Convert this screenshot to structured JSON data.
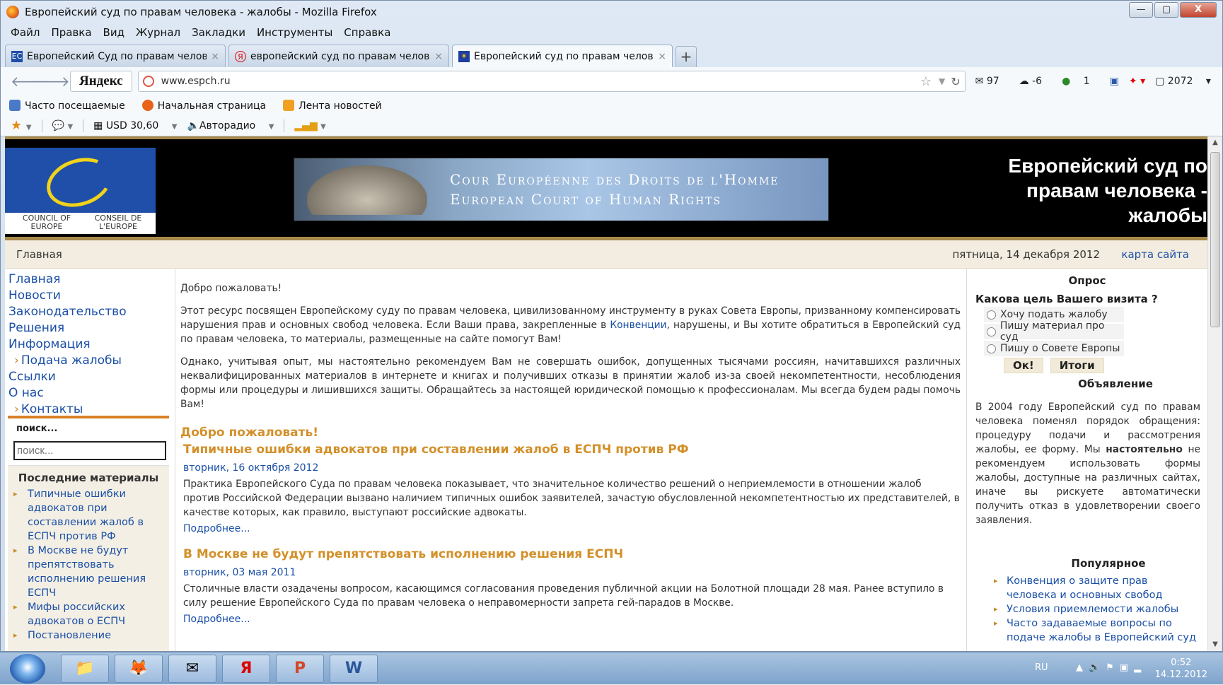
{
  "window": {
    "title": "Европейский суд по правам человека - жалобы - Mozilla Firefox",
    "buttons": [
      "—",
      "▢",
      "X"
    ]
  },
  "menubar": [
    "Файл",
    "Правка",
    "Вид",
    "Журнал",
    "Закладки",
    "Инструменты",
    "Справка"
  ],
  "tabs": [
    {
      "label": "Европейский Суд по правам челове...",
      "active": false
    },
    {
      "label": "европейский суд по правам челове...",
      "active": false
    },
    {
      "label": "Европейский суд по правам челове...",
      "active": true
    }
  ],
  "nav": {
    "yandex": "Яндекс",
    "url": "www.espch.ru",
    "mail_count": "97",
    "weather": "-6",
    "counter1": "1",
    "counter2": "2072"
  },
  "bookmarks": [
    "Часто посещаемые",
    "Начальная страница",
    "Лента новостей"
  ],
  "yabar": {
    "usd": "USD 30,60",
    "radio": "Авторадио"
  },
  "header": {
    "coe_en": "COUNCIL OF EUROPE",
    "coe_fr": "CONSEIL DE L'EUROPE",
    "banner_line1": "Cour Européenne des Droits de l'Homme",
    "banner_line2": "European Court of Human Rights",
    "site_title": "Европейский суд по правам человека - жалобы"
  },
  "crumb": {
    "home": "Главная",
    "date": "пятница, 14 декабря 2012",
    "sitemap": "карта сайта"
  },
  "leftmenu": [
    {
      "label": "Главная",
      "sub": false
    },
    {
      "label": "Новости",
      "sub": false
    },
    {
      "label": "Законодательство",
      "sub": false
    },
    {
      "label": "Решения",
      "sub": false
    },
    {
      "label": "Информация",
      "sub": false
    },
    {
      "label": "Подача жалобы",
      "sub": true
    },
    {
      "label": "Ссылки",
      "sub": false
    },
    {
      "label": "О нас",
      "sub": false
    },
    {
      "label": "Контакты",
      "sub": true
    }
  ],
  "search": {
    "label": "поиск...",
    "placeholder": "поиск..."
  },
  "recent": {
    "title": "Последние материалы",
    "items": [
      "Типичные ошибки адвокатов при составлении жалоб в ЕСПЧ против РФ",
      "В Москве не будут препятствовать исполнению решения ЕСПЧ",
      "Мифы российских адвокатов о ЕСПЧ",
      "Постановление"
    ]
  },
  "main": {
    "welcome": "Добро пожаловать!",
    "p1_before": "Этот ресурс посвящен Европейскому суду по правам человека, цивилизованному инструменту в руках Совета Европы, призванному компенсировать нарушения прав и основных свобод человека. Если Ваши права, закрепленные в ",
    "p1_link": "Конвенции",
    "p1_after": ", нарушены, и Вы хотите обратиться в Европейский суд по правам человека, то материалы, размещенные на сайте помогут Вам!",
    "p2": "Однако, учитывая опыт, мы настоятельно рекомендуем Вам не совершать ошибок, допущенных тысячами россиян, начитавшихся различных неквалифицированных материалов в интернете и книгах и получивших отказы в принятии жалоб из-за своей некомпетентности, несоблюдения формы или процедуры и лишившихся защиты. Обращайтесь за настоящей юридической помощью к профессионалам. Мы всегда будем рады помочь Вам!",
    "heading": "Добро пожаловать!",
    "articles": [
      {
        "title": "Типичные ошибки адвокатов при составлении жалоб в ЕСПЧ против РФ",
        "date": "вторник, 16 октября 2012",
        "text": "Практика Европейского Суда по правам человека показывает, что значительное количество решений о неприемлемости в отношении жалоб против Российской Федерации вызвано наличием типичных ошибок заявителей, зачастую обусловленной некомпетентностью их представителей, в качестве которых, как правило, выступают российские адвокаты.",
        "more": "Подробнее..."
      },
      {
        "title": "В Москве не будут препятствовать исполнению решения ЕСПЧ",
        "date": "вторник, 03 мая 2011",
        "text": "Столичные власти озадачены вопросом, касающимся согласования проведения публичной акции на Болотной площади 28 мая. Ранее вступило в силу решение Европейского Суда по правам человека о неправомерности запрета гей-парадов в Москве.",
        "more": "Подробнее..."
      }
    ]
  },
  "poll": {
    "title": "Опрос",
    "question": "Какова цель Вашего визита ?",
    "options": [
      "Хочу подать жалобу",
      "Пишу материал про суд",
      "Пишу о Совете Европы"
    ],
    "ok": "Ок!",
    "results": "Итоги"
  },
  "announce": {
    "title": "Объявление",
    "text_before": "В 2004 году Европейский суд по правам человека поменял порядок обращения: процедуру подачи и рассмотрения жалобы, ее форму. Мы ",
    "text_bold": "настоятельно",
    "text_after": " не рекомендуем использовать формы жалобы, доступные на различных сайтах, иначе вы рискуете автоматически получить отказ в удовлетворении своего заявления."
  },
  "popular": {
    "title": "Популярное",
    "items": [
      "Конвенция о защите прав человека и основных свобод",
      "Условия приемлемости жалобы",
      "Часто задаваемые вопросы по подаче жалобы в Европейский суд"
    ]
  },
  "taskbar": {
    "lang": "RU",
    "time": "0:52",
    "date": "14.12.2012"
  }
}
